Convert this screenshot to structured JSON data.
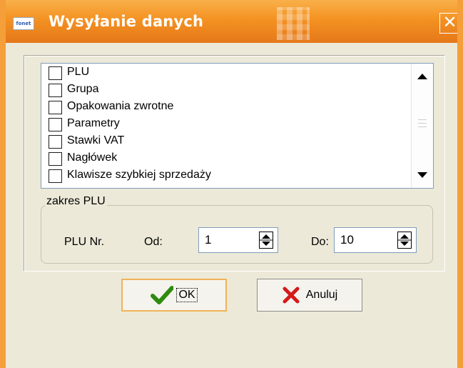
{
  "window": {
    "title": "Wysyłanie danych",
    "app_icon_text": "fonet",
    "close_glyph": "✕"
  },
  "list": {
    "items": [
      {
        "label": "PLU",
        "checked": false
      },
      {
        "label": "Grupa",
        "checked": false
      },
      {
        "label": "Opakowania zwrotne",
        "checked": false
      },
      {
        "label": "Parametry",
        "checked": false
      },
      {
        "label": "Stawki VAT",
        "checked": false
      },
      {
        "label": "Nagłówek",
        "checked": false
      },
      {
        "label": "Klawisze szybkiej sprzedaży",
        "checked": false
      }
    ]
  },
  "range": {
    "legend": "zakres PLU",
    "plu_label": "PLU Nr.",
    "from_label": "Od:",
    "from_value": "1",
    "to_label": "Do:",
    "to_value": "10"
  },
  "buttons": {
    "ok_label": "OK",
    "cancel_label": "Anuluj"
  },
  "colors": {
    "title_bar": "#f49222",
    "ok_icon": "#2e8b0e",
    "cancel_icon": "#d51a1a"
  }
}
